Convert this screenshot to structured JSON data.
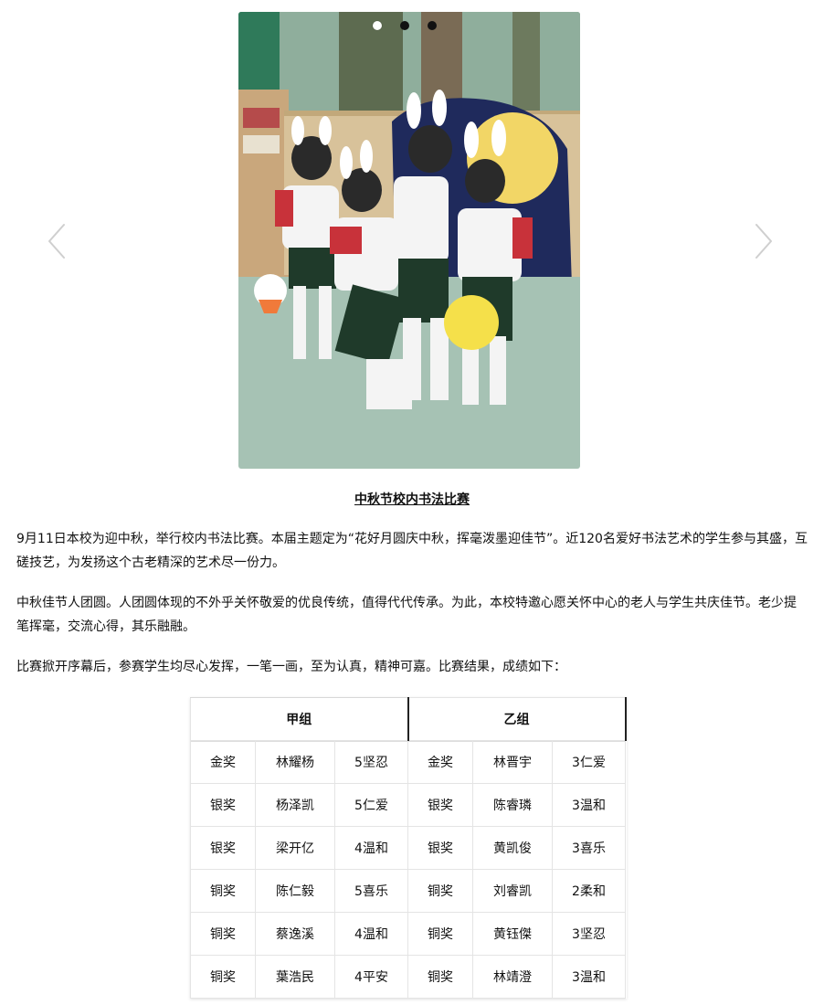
{
  "carousel": {
    "photo_icon": "photo-students-mid-autumn",
    "dot_count": 3,
    "active_dot": 0,
    "prev_icon": "chevron-left-icon",
    "next_icon": "chevron-right-icon"
  },
  "article": {
    "title": "中秋节校内书法比赛",
    "paragraphs": [
      "9月11日本校为迎中秋，举行校内书法比赛。本届主题定为“花好月圆庆中秋，挥毫泼墨迎佳节”。近120名爱好书法艺术的学生参与其盛，互磋技艺，为发扬这个古老精深的艺术尽一份力。",
      "中秋佳节人团圆。人团圆体现的不外乎关怀敬爱的优良传统，值得代代传承。为此，本校特邀心愿关怀中心的老人与学生共庆佳节。老少提笔挥毫，交流心得，其乐融融。",
      "比赛掀开序幕后，参赛学生均尽心发挥，一笔一画，至为认真，精神可嘉。比赛结果，成绩如下："
    ]
  },
  "results": {
    "group_a": "甲组",
    "group_b": "乙组",
    "rows": [
      [
        "金奖",
        "林耀杨",
        "5坚忍",
        "金奖",
        "林晋宇",
        "3仁爱"
      ],
      [
        "银奖",
        "杨泽凯",
        "5仁爱",
        "银奖",
        "陈睿璘",
        "3温和"
      ],
      [
        "银奖",
        "梁开亿",
        "4温和",
        "银奖",
        "黄凯俊",
        "3喜乐"
      ],
      [
        "铜奖",
        "陈仁毅",
        "5喜乐",
        "铜奖",
        "刘睿凯",
        "2柔和"
      ],
      [
        "铜奖",
        "蔡逸溪",
        "4温和",
        "铜奖",
        "黄钰傑",
        "3坚忍"
      ],
      [
        "铜奖",
        "葉浩民",
        "4平安",
        "铜奖",
        "林靖澄",
        "3温和"
      ]
    ]
  }
}
